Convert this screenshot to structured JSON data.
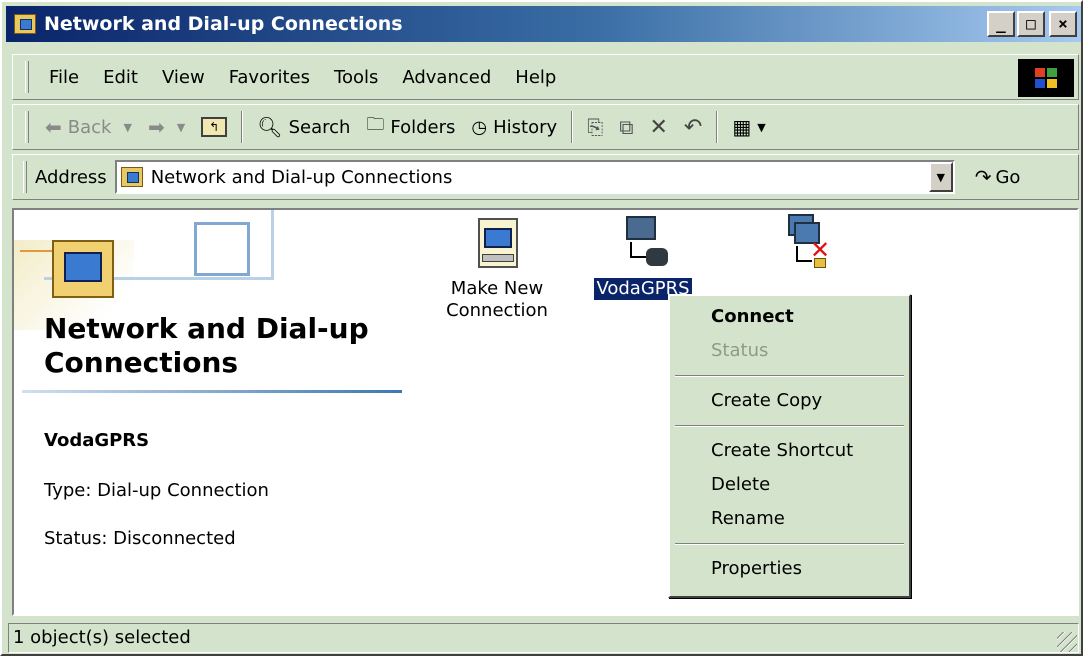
{
  "window": {
    "title": "Network and Dial-up Connections",
    "buttons": {
      "minimize": "_",
      "maximize": "□",
      "close": "×"
    }
  },
  "menubar": {
    "items": [
      "File",
      "Edit",
      "View",
      "Favorites",
      "Tools",
      "Advanced",
      "Help"
    ]
  },
  "toolbar": {
    "back": "Back",
    "search": "Search",
    "folders": "Folders",
    "history": "History"
  },
  "address": {
    "label": "Address",
    "value": "Network and Dial-up Connections",
    "go": "Go"
  },
  "left_pane": {
    "title": "Network and Dial-up Connections",
    "selected_name": "VodaGPRS",
    "type_line": "Type: Dial-up Connection",
    "status_line": "Status: Disconnected"
  },
  "icons": [
    {
      "label_line1": "Make New",
      "label_line2": "Connection"
    },
    {
      "label_line1": "VodaGPRS",
      "label_line2": ""
    },
    {
      "label_line1": "",
      "label_line2": ""
    }
  ],
  "context_menu": {
    "connect": "Connect",
    "status": "Status",
    "create_copy": "Create Copy",
    "create_shortcut": "Create Shortcut",
    "delete": "Delete",
    "rename": "Rename",
    "properties": "Properties"
  },
  "statusbar": {
    "text": "1 object(s) selected"
  },
  "colors": {
    "window_bg": "#d4e4cc",
    "title_start": "#0a246a",
    "title_end": "#a6caf0",
    "selection": "#0a246a"
  }
}
